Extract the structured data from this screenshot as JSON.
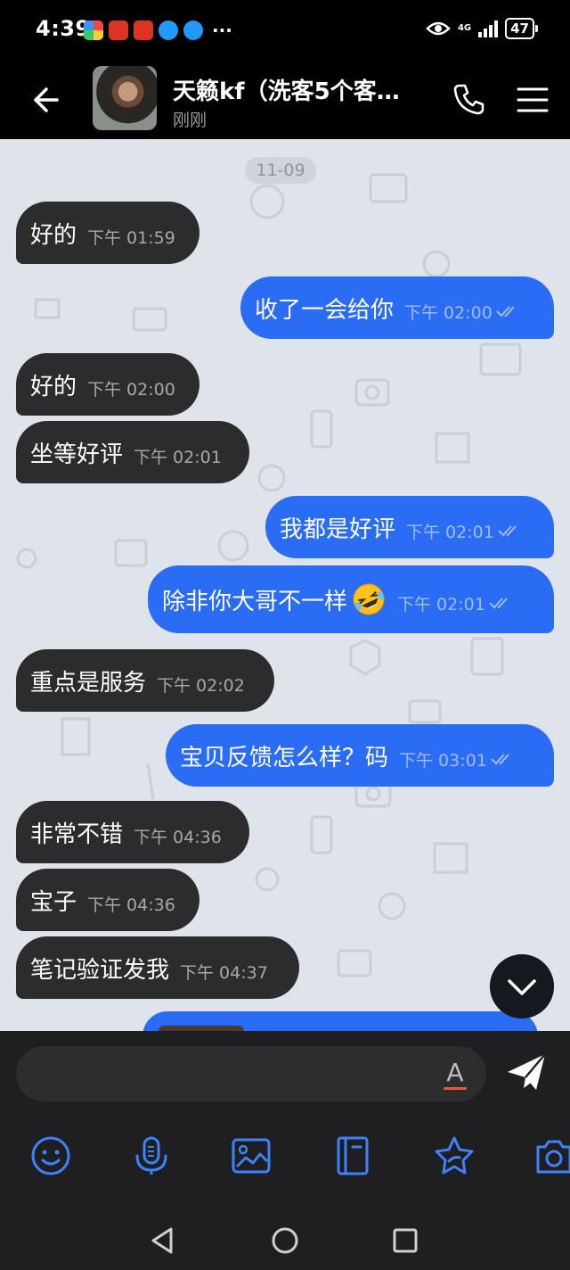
{
  "status_bar": {
    "time": "4:39",
    "network": "4G",
    "battery": "47"
  },
  "header": {
    "title": "天籁kf（洗客5个客…",
    "subtitle": "刚刚"
  },
  "date_divider": "11-09",
  "messages": [
    {
      "side": "in",
      "text": "好的",
      "time": "下午 01:59"
    },
    {
      "side": "out",
      "text": "收了一会给你",
      "time": "下午 02:00"
    },
    {
      "side": "in",
      "text": "好的",
      "time": "下午 02:00"
    },
    {
      "side": "in",
      "text": "坐等好评",
      "time": "下午 02:01"
    },
    {
      "side": "out",
      "text": "我都是好评",
      "time": "下午 02:01"
    },
    {
      "side": "out",
      "text": "除非你大哥不一样",
      "time": "下午 02:01",
      "emoji": "rolling-on-floor-laughing-emoji"
    },
    {
      "side": "in",
      "text": "重点是服务",
      "time": "下午 02:02"
    },
    {
      "side": "out",
      "text": "宝贝反馈怎么样？码",
      "time": "下午 03:01"
    },
    {
      "side": "in",
      "text": "非常不错",
      "time": "下午 04:36"
    },
    {
      "side": "in",
      "text": "宝子",
      "time": "下午 04:36"
    },
    {
      "side": "in",
      "text": "笔记验证发我",
      "time": "下午 04:37"
    }
  ],
  "input": {
    "font_button": "A"
  },
  "colors": {
    "outgoing_bubble": "#2a6df4",
    "incoming_bubble": "#2c2c2e",
    "chat_background": "#dfe3ea",
    "bar_background": "#1f1f21"
  },
  "toolbar_icons": [
    "emoji-icon",
    "voice-icon",
    "image-icon",
    "notes-icon",
    "star-icon",
    "camera-icon"
  ]
}
